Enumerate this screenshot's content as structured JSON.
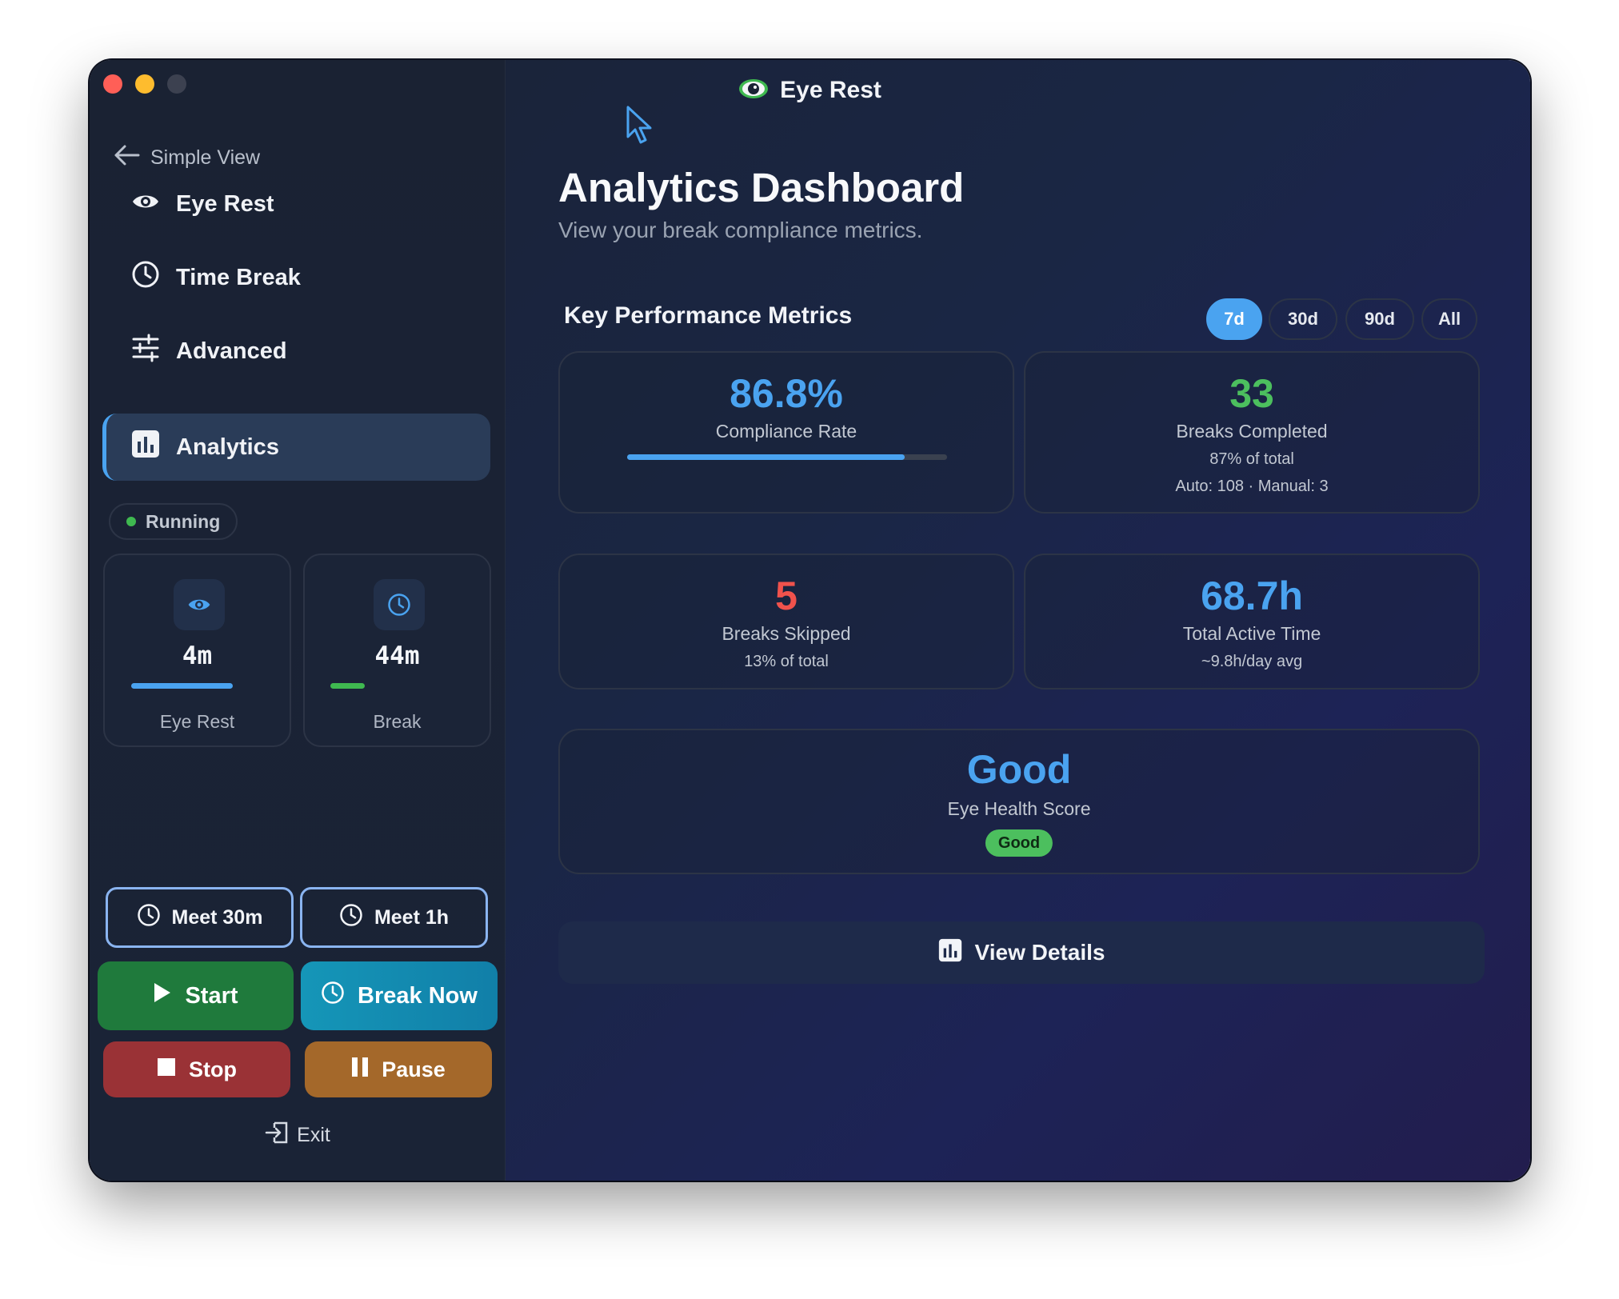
{
  "window": {
    "title": "Eye Rest"
  },
  "sidebar": {
    "back_label": "Simple View",
    "nav": [
      {
        "label": "Eye Rest",
        "icon": "eye-icon",
        "active": false
      },
      {
        "label": "Time Break",
        "icon": "clock-icon",
        "active": false
      },
      {
        "label": "Advanced",
        "icon": "sliders-icon",
        "active": false
      },
      {
        "label": "Analytics",
        "icon": "bar-chart-icon",
        "active": true
      }
    ],
    "status": "Running",
    "timers": [
      {
        "value": "4m",
        "label": "Eye Rest",
        "icon": "eye-icon",
        "color": "#4aa3f0",
        "progress": 1.0
      },
      {
        "value": "44m",
        "label": "Break",
        "icon": "clock-icon",
        "color": "#3fb950",
        "progress": 0.25
      }
    ],
    "meet_buttons": [
      "Meet 30m",
      "Meet 1h"
    ],
    "actions": {
      "start": "Start",
      "break_now": "Break Now",
      "stop": "Stop",
      "pause": "Pause"
    },
    "exit_label": "Exit"
  },
  "main": {
    "title": "Analytics Dashboard",
    "subtitle": "View your break compliance metrics.",
    "section_title": "Key Performance Metrics",
    "ranges": [
      {
        "label": "7d",
        "active": true
      },
      {
        "label": "30d",
        "active": false
      },
      {
        "label": "90d",
        "active": false
      },
      {
        "label": "All",
        "active": false
      }
    ],
    "metrics": {
      "compliance": {
        "value": "86.8%",
        "label": "Compliance Rate",
        "progress": 0.868,
        "color": "#4aa3f0"
      },
      "completed": {
        "value": "33",
        "label": "Breaks Completed",
        "sub1": "87% of total",
        "sub2": "Auto: 108 · Manual: 3",
        "color": "#4cbf5e"
      },
      "skipped": {
        "value": "5",
        "label": "Breaks Skipped",
        "sub1": "13% of total",
        "color": "#f0524c"
      },
      "active_time": {
        "value": "68.7h",
        "label": "Total Active Time",
        "sub1": "~9.8h/day avg",
        "color": "#4aa3f0"
      },
      "health": {
        "value": "Good",
        "label": "Eye Health Score",
        "badge": "Good",
        "color": "#4aa3f0"
      }
    },
    "details_button": "View Details"
  }
}
